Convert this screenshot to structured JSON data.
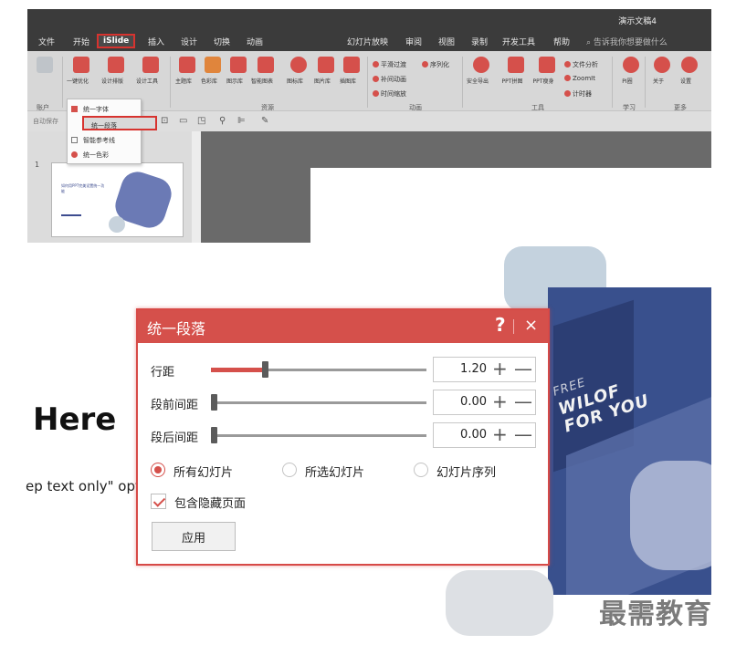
{
  "window": {
    "doc_title": "演示文稿4"
  },
  "tabs": [
    "文件",
    "开始",
    "iSlide",
    "插入",
    "设计",
    "切换",
    "动画",
    "幻灯片放映",
    "审阅",
    "视图",
    "录制",
    "开发工具",
    "帮助"
  ],
  "tab_search": "告诉我你想要做什么",
  "ribbon": {
    "buttons": [
      "一键优化",
      "设计排版",
      "设计工具",
      "主题库",
      "色彩库",
      "图示库",
      "智能图表",
      "图标库",
      "图片库",
      "插图库",
      "安全导出",
      "PPT拼图",
      "PPT瘦身",
      "PI圈",
      "关于",
      "设置"
    ],
    "small_left": [
      "平滑过渡",
      "补间动画",
      "时间缩放"
    ],
    "small_seq": "序列化",
    "small_right": [
      "文件分析",
      "ZoomIt",
      "计时器"
    ],
    "groups": [
      "账户",
      "资源",
      "动画",
      "工具",
      "学习",
      "更多"
    ]
  },
  "qat": {
    "autosave": "自动保存"
  },
  "dropdown": {
    "items": [
      "统一字体",
      "统一段落",
      "智能参考线",
      "统一色彩"
    ]
  },
  "thumbnail": {
    "number": "1",
    "title": "如何用PPT完美设置统一功能"
  },
  "slide": {
    "heading": "Here",
    "body": "ep text only\" opti"
  },
  "photo_text": {
    "line1": "FREE",
    "line2": "WILOF",
    "line3": "FOR YOU"
  },
  "watermark": "最需教育",
  "dialog": {
    "title": "统一段落",
    "help": "?",
    "close": "×",
    "line_spacing": {
      "label": "行距",
      "value": "1.20",
      "fraction": 0.25
    },
    "space_before": {
      "label": "段前间距",
      "value": "0.00",
      "fraction": 0.0
    },
    "space_after": {
      "label": "段后间距",
      "value": "0.00",
      "fraction": 0.0
    },
    "plus": "+",
    "minus": "—",
    "scope": [
      "所有幻灯片",
      "所选幻灯片",
      "幻灯片序列"
    ],
    "scope_selected": 0,
    "include_hidden": "包含隐藏页面",
    "include_hidden_checked": true,
    "apply": "应用"
  },
  "colors": {
    "accent": "#d5504b",
    "photo": "#39508d"
  }
}
